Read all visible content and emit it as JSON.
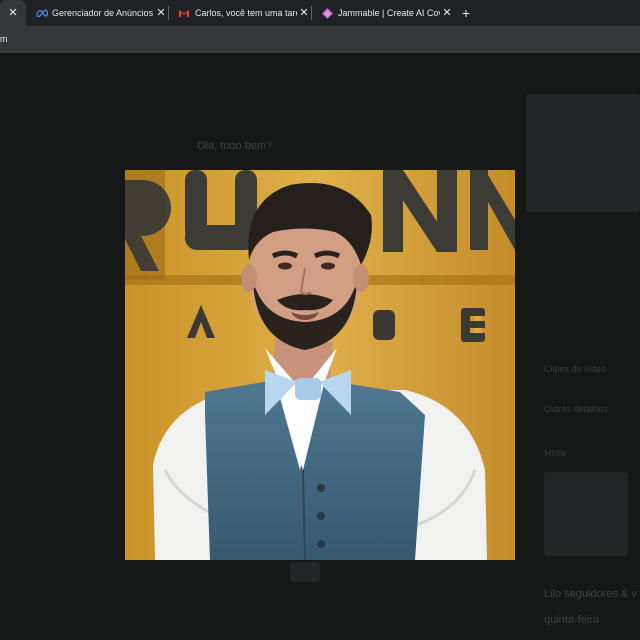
{
  "tabs": [
    {
      "title": "",
      "icon": "close-icon",
      "active": true
    },
    {
      "title": "Gerenciador de Anúncios - G",
      "icon": "meta-icon"
    },
    {
      "title": "Carlos, você tem uma tarefa",
      "icon": "gmail-icon"
    },
    {
      "title": "Jammable | Create AI Covers",
      "icon": "jammable-icon"
    }
  ],
  "address": {
    "text": "m"
  },
  "background": {
    "caption": "Ola, tudo bem?",
    "side_item_1": "Clipes de vídeo",
    "side_item_2": "Outros detalhes",
    "side_item_3": "Mídia",
    "bottom_text_1": "Lilo seguidores & v",
    "bottom_text_2": "quinta-feira"
  },
  "photo": {
    "alt": "man in blue vest and light blue bow tie"
  },
  "colors": {
    "backdrop": "#121414",
    "tabbar": "#202124",
    "active_tab": "#35363a",
    "wall": "#d6a43a"
  }
}
